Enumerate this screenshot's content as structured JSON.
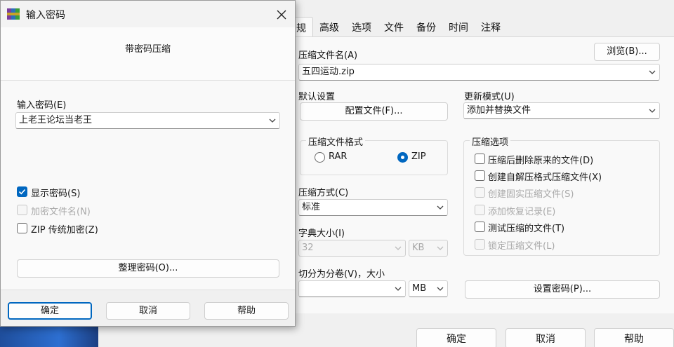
{
  "background_dialog": {
    "tabs": [
      {
        "label": "常规",
        "visible": "规",
        "active": true
      },
      {
        "label": "高级"
      },
      {
        "label": "选项"
      },
      {
        "label": "文件"
      },
      {
        "label": "备份"
      },
      {
        "label": "时间"
      },
      {
        "label": "注释"
      }
    ],
    "archive_name_label": "压缩文件名(A)",
    "archive_name_value": "五四运动.zip",
    "browse_button": "浏览(B)...",
    "default_settings_label": "默认设置",
    "profiles_button": "配置文件(F)...",
    "update_mode_label": "更新模式(U)",
    "update_mode_value": "添加并替换文件",
    "format_group_title": "压缩文件格式",
    "format_rar": "RAR",
    "format_zip": "ZIP",
    "format_selected": "ZIP",
    "method_label": "压缩方式(C)",
    "method_value": "标准",
    "dict_label": "字典大小(I)",
    "dict_value": "32",
    "dict_unit": "KB",
    "split_label": "切分为分卷(V)，大小",
    "split_value": "",
    "split_unit": "MB",
    "options_group_title": "压缩选项",
    "options": [
      {
        "label": "压缩后删除原来的文件(D)",
        "checked": false,
        "enabled": true
      },
      {
        "label": "创建自解压格式压缩文件(X)",
        "checked": false,
        "enabled": true
      },
      {
        "label": "创建固实压缩文件(S)",
        "checked": false,
        "enabled": false
      },
      {
        "label": "添加恢复记录(E)",
        "checked": false,
        "enabled": false
      },
      {
        "label": "测试压缩的文件(T)",
        "checked": false,
        "enabled": true
      },
      {
        "label": "锁定压缩文件(L)",
        "checked": false,
        "enabled": false
      }
    ],
    "set_password_button": "设置密码(P)...",
    "ok_button": "确定",
    "cancel_button": "取消",
    "help_button": "帮助"
  },
  "password_dialog": {
    "title": "输入密码",
    "header": "带密码压缩",
    "password_label": "输入密码(E)",
    "password_value": "上老王论坛当老王",
    "show_password": {
      "label": "显示密码(S)",
      "checked": true,
      "enabled": true
    },
    "encrypt_names": {
      "label": "加密文件名(N)",
      "checked": false,
      "enabled": false
    },
    "zip_legacy": {
      "label": "ZIP 传统加密(Z)",
      "checked": false,
      "enabled": true
    },
    "organize_button": "整理密码(O)...",
    "ok_button": "确定",
    "cancel_button": "取消",
    "help_button": "帮助"
  },
  "colors": {
    "accent": "#0067c0",
    "taskbar": "#2d6fd1"
  },
  "icons": {
    "archive": "winrar-icon",
    "close": "close-icon",
    "dropdown": "chevron-down-icon",
    "check": "checkmark-icon"
  }
}
